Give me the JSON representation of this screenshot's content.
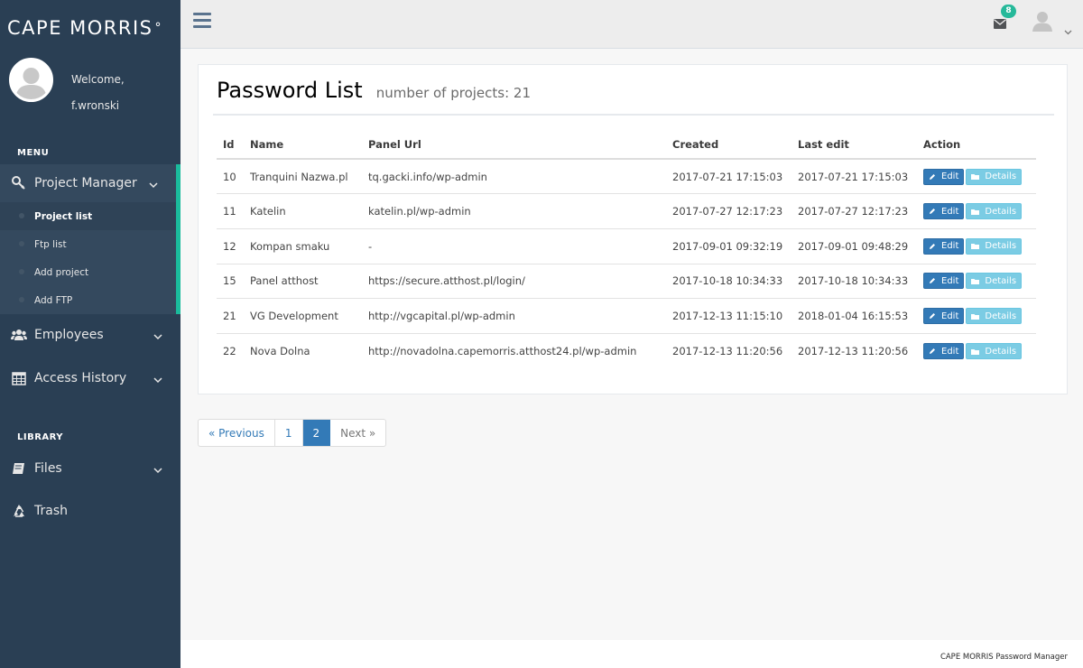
{
  "brand": {
    "name": "CAPE MORRIS",
    "mark": "°"
  },
  "profile": {
    "welcome": "Welcome,",
    "username": "f.wronski"
  },
  "sidebar": {
    "menu_title": "MENU",
    "library_title": "LIBRARY",
    "items": [
      {
        "label": "Project Manager",
        "icon": "wrench-icon"
      },
      {
        "label": "Employees",
        "icon": "users-icon"
      },
      {
        "label": "Access History",
        "icon": "calendar-icon"
      },
      {
        "label": "Files",
        "icon": "book-icon"
      },
      {
        "label": "Trash",
        "icon": "recycle-icon"
      }
    ],
    "submenu": [
      "Project list",
      "Ftp list",
      "Add project",
      "Add FTP"
    ]
  },
  "topbar": {
    "notifications": "8"
  },
  "page": {
    "title": "Password List",
    "subtitle": "number of projects: 21"
  },
  "table": {
    "headers": [
      "Id",
      "Name",
      "Panel Url",
      "Created",
      "Last edit",
      "Action"
    ],
    "edit_label": "Edit",
    "details_label": "Details",
    "rows": [
      {
        "id": "10",
        "name": "Tranquini Nazwa.pl",
        "url": "tq.gacki.info/wp-admin",
        "created": "2017-07-21 17:15:03",
        "edited": "2017-07-21 17:15:03"
      },
      {
        "id": "11",
        "name": "Katelin",
        "url": "katelin.pl/wp-admin",
        "created": "2017-07-27 12:17:23",
        "edited": "2017-07-27 12:17:23"
      },
      {
        "id": "12",
        "name": "Kompan smaku",
        "url": "-",
        "created": "2017-09-01 09:32:19",
        "edited": "2017-09-01 09:48:29"
      },
      {
        "id": "15",
        "name": "Panel atthost",
        "url": "https://secure.atthost.pl/login/",
        "created": "2017-10-18 10:34:33",
        "edited": "2017-10-18 10:34:33"
      },
      {
        "id": "21",
        "name": "VG Development",
        "url": "http://vgcapital.pl/wp-admin",
        "created": "2017-12-13 11:15:10",
        "edited": "2018-01-04 16:15:53"
      },
      {
        "id": "22",
        "name": "Nova Dolna",
        "url": "http://novadolna.capemorris.atthost24.pl/wp-admin",
        "created": "2017-12-13 11:20:56",
        "edited": "2017-12-13 11:20:56"
      }
    ]
  },
  "pagination": {
    "prev": "« Previous",
    "pages": [
      "1",
      "2"
    ],
    "current": "2",
    "next": "Next »"
  },
  "footer": {
    "text": "CAPE MORRIS Password Manager"
  },
  "colors": {
    "sidebar": "#2a3f54",
    "accent": "#1abb9c",
    "primary": "#337ab7",
    "info": "#5bc0de"
  }
}
